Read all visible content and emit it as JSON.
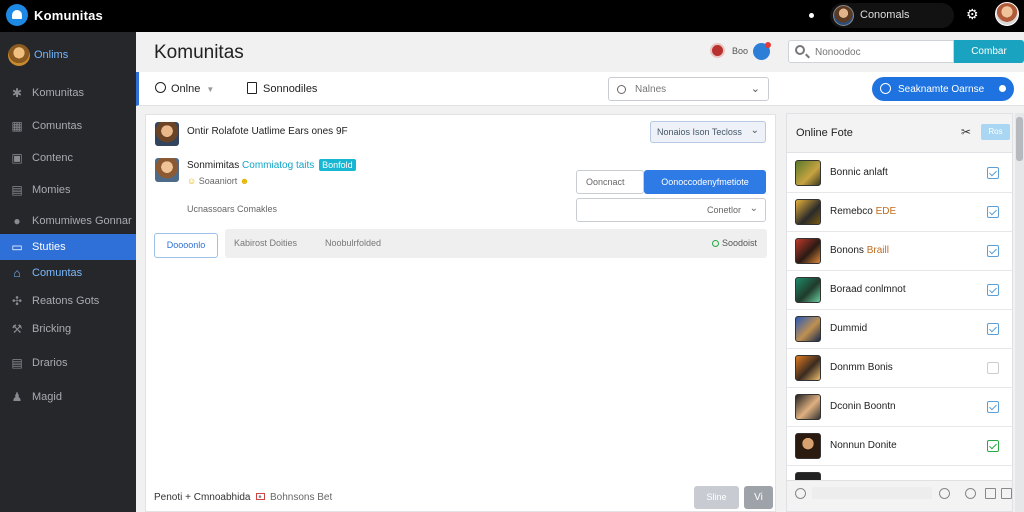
{
  "app": {
    "title": "Komunitas"
  },
  "topbar": {
    "user_name": "Conomals"
  },
  "sidebar": {
    "brand_label": "Onlims",
    "items": [
      {
        "label": "Komunitas",
        "icon": "gear-icon"
      },
      {
        "label": "Comuntas",
        "icon": "grid-icon"
      },
      {
        "label": "Contenc",
        "icon": "camera-icon"
      },
      {
        "label": "Momies",
        "icon": "chart-icon"
      },
      {
        "label": "Komumiwes Gonnar",
        "icon": "gear-icon"
      },
      {
        "label": "Stuties",
        "icon": "window-icon",
        "state": "active"
      },
      {
        "label": "Comuntas",
        "icon": "home-icon",
        "state": "highlight"
      },
      {
        "label": "Reatons Gots",
        "icon": "people-icon"
      },
      {
        "label": "Bricking",
        "icon": "wrench-icon"
      },
      {
        "label": "Drarios",
        "icon": "document-icon"
      },
      {
        "label": "Magid",
        "icon": "person-icon"
      }
    ]
  },
  "header": {
    "page_title": "Komunitas",
    "user_label": "Boo",
    "search_placeholder": "Nonoodoc",
    "search_button": "Combar"
  },
  "tabbar": {
    "tab_online": "Onlne",
    "tab_contacts": "Sonnodiles",
    "dropdown_value": "Nalnes",
    "primary_button": "Seaknamte Oarnse"
  },
  "content": {
    "row1_text": "Ontir Rolafote Uatlime Ears ones 9F",
    "row1_button": "Nonaios Ison Tecloss",
    "row2_name": "Sonmimitas",
    "row2_link": "Commiatog taits",
    "row2_chip": "Bonfold",
    "row2_sub": "Soaaniort",
    "row3_text": "Ucnassoars Comakles",
    "btn_white1": "Ooncnact",
    "btn_blue": "Oonoccodenyfmetiote",
    "btn_white2": "Conetlor",
    "bar_button": "Doooonlo",
    "bar_text1": "Kabirost Doities",
    "bar_text2": "Noobulrfolded",
    "bar_status": "Soodoist"
  },
  "footer": {
    "text1": "Penoti + Cmnoabhida",
    "sep": "•",
    "text2": "Bohnsons Bet",
    "button1": "Sline",
    "button2": "Vi"
  },
  "right_panel": {
    "title": "Online Fote",
    "mini_button": "Ros",
    "items": [
      {
        "name": "Bonnic anlaft",
        "checked": false,
        "style": "check"
      },
      {
        "name": "Remebco",
        "tag": "EDE",
        "checked": false,
        "style": "check"
      },
      {
        "name": "Bonons",
        "tag": "Braill",
        "checked": false,
        "style": "check"
      },
      {
        "name": "Boraad conlmnot",
        "checked": false,
        "style": "check"
      },
      {
        "name": "Dummid",
        "checked": false,
        "style": "check"
      },
      {
        "name": "Donmm Bonis",
        "checked": false,
        "style": "plain"
      },
      {
        "name": "Dconin Boontn",
        "checked": false,
        "style": "check"
      },
      {
        "name": "Nonnun Donite",
        "checked": true,
        "style": "check"
      }
    ]
  },
  "colors": {
    "accent": "#2f6fd8",
    "topbar": "#000000",
    "sidebar": "#26272b",
    "search_button": "#1aa3c1",
    "chip": "#17b6d3",
    "success": "#29a745"
  }
}
